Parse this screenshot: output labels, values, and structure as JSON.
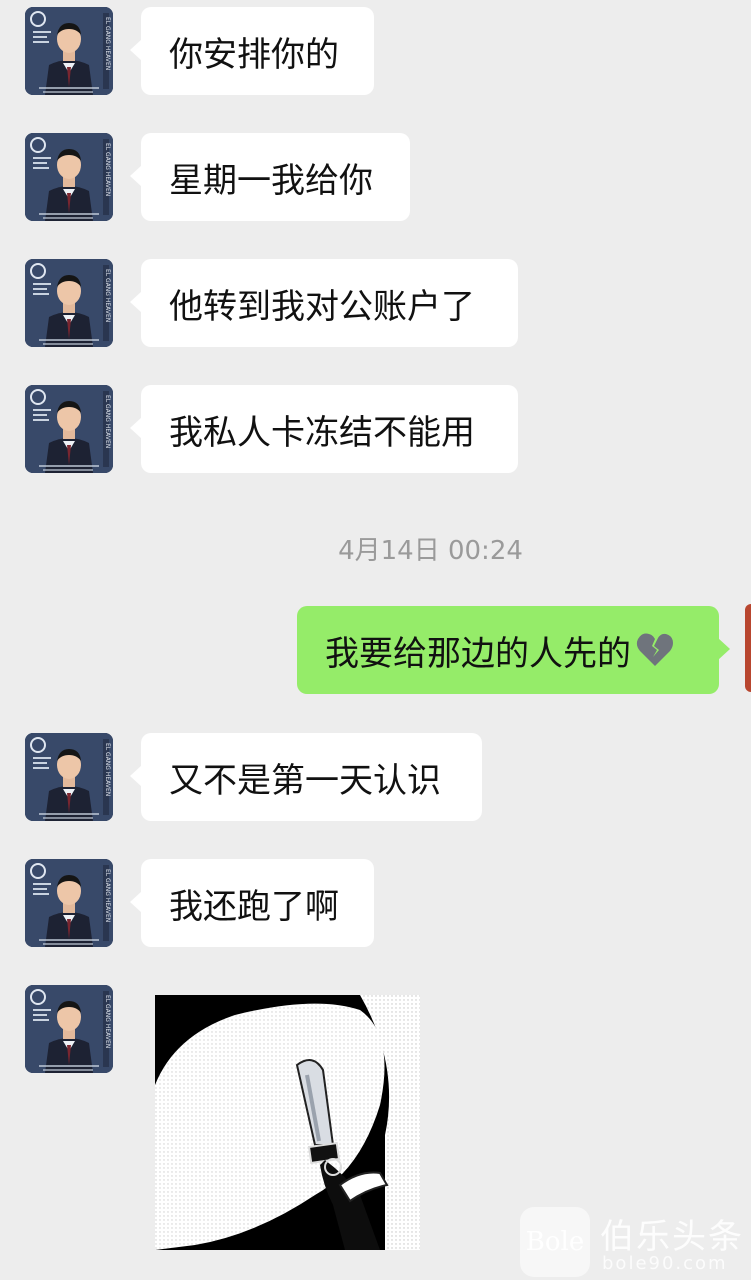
{
  "messages": [
    {
      "from": "contact",
      "type": "text",
      "text": "你安排你的"
    },
    {
      "from": "contact",
      "type": "text",
      "text": "星期一我给你"
    },
    {
      "from": "contact",
      "type": "text",
      "text": "他转到我对公账户了"
    },
    {
      "from": "contact",
      "type": "text",
      "text": "我私人卡冻结不能用"
    },
    {
      "from": "me",
      "type": "text",
      "text": "我要给那边的人先的",
      "emoji": "broken-heart-icon"
    },
    {
      "from": "contact",
      "type": "text",
      "text": "又不是第一天认识"
    },
    {
      "from": "contact",
      "type": "text",
      "text": "我还跑了啊"
    },
    {
      "from": "contact",
      "type": "sticker",
      "sticker": "knife-sticker"
    }
  ],
  "timestamp": "4月14日 00:24",
  "watermark": {
    "logo_text": "Bole",
    "title": "伯乐头条",
    "url": "bole90.com"
  },
  "colors": {
    "background": "#ededed",
    "incoming_bubble": "#ffffff",
    "outgoing_bubble": "#95ec69",
    "timestamp_text": "#9a9a9a"
  }
}
